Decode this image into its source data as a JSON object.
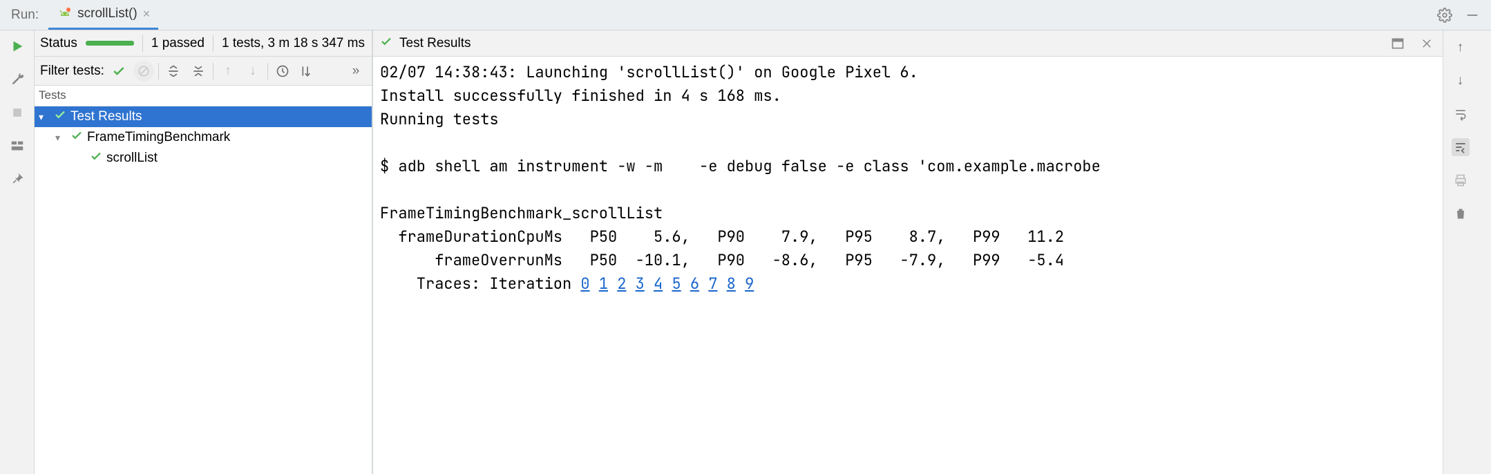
{
  "title_bar": {
    "run_label": "Run:",
    "tab_label": "scrollList()"
  },
  "status": {
    "status_word": "Status",
    "passed_text": "1 passed",
    "summary_text": "1 tests, 3 m 18 s 347 ms"
  },
  "filter": {
    "label": "Filter tests:"
  },
  "tests_header": "Tests",
  "tree": {
    "root_label": "Test Results",
    "class_label": "FrameTimingBenchmark",
    "method_label": "scrollList"
  },
  "console_header": {
    "title": "Test Results"
  },
  "console": {
    "line1": "02/07 14:38:43: Launching 'scrollList()' on Google Pixel 6.",
    "line2": "Install successfully finished in 4 s 168 ms.",
    "line3": "Running tests",
    "line4": "",
    "line5": "$ adb shell am instrument -w -m    -e debug false -e class 'com.example.macrobe",
    "line6": "",
    "line7": "FrameTimingBenchmark_scrollList",
    "line8": "  frameDurationCpuMs   P50    5.6,   P90    7.9,   P95    8.7,   P99   11.2",
    "line9": "      frameOverrunMs   P50  -10.1,   P90   -8.6,   P95   -7.9,   P99   -5.4",
    "traces_prefix": "    Traces: Iteration ",
    "trace_links": [
      "0",
      "1",
      "2",
      "3",
      "4",
      "5",
      "6",
      "7",
      "8",
      "9"
    ]
  }
}
